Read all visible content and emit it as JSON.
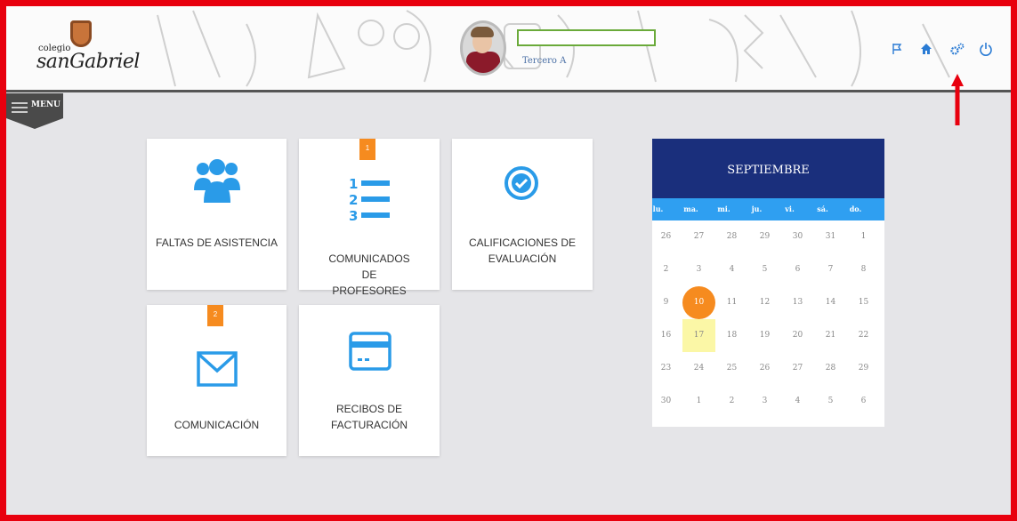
{
  "header": {
    "logo_small": "colegio",
    "logo_big": "sanGabriel",
    "student_name": "",
    "student_grade": "Tercero A",
    "icons": [
      "flag-icon",
      "home-icon",
      "settings-gears-icon",
      "power-icon"
    ]
  },
  "menu": {
    "label": "MENU"
  },
  "tiles": [
    {
      "title": "FALTAS DE ASISTENCIA",
      "icon": "users-icon",
      "badge": ""
    },
    {
      "title": "COMUNICADOS DE PROFESORES",
      "icon": "numbered-list-icon",
      "badge": "1"
    },
    {
      "title": "CALIFICACIONES DE EVALUACIÓN",
      "icon": "check-circle-icon",
      "badge": ""
    },
    {
      "title": "COMUNICACIÓN",
      "icon": "envelope-icon",
      "badge": "2"
    },
    {
      "title": "RECIBOS DE FACTURACIÓN",
      "icon": "credit-card-icon",
      "badge": ""
    }
  ],
  "calendar": {
    "month": "SEPTIEMBRE",
    "weekdays": [
      "lu.",
      "ma.",
      "mi.",
      "ju.",
      "vi.",
      "sá.",
      "do."
    ],
    "weeks": [
      [
        "26",
        "27",
        "28",
        "29",
        "30",
        "31",
        "1"
      ],
      [
        "2",
        "3",
        "4",
        "5",
        "6",
        "7",
        "8"
      ],
      [
        "9",
        "10",
        "11",
        "12",
        "13",
        "14",
        "15"
      ],
      [
        "16",
        "17",
        "18",
        "19",
        "20",
        "21",
        "22"
      ],
      [
        "23",
        "24",
        "25",
        "26",
        "27",
        "28",
        "29"
      ],
      [
        "30",
        "1",
        "2",
        "3",
        "4",
        "5",
        "6"
      ]
    ],
    "selected_day": "10",
    "today_day": "17",
    "colors": {
      "header": "#1a2f7c",
      "weekday_bar": "#2f9ff1",
      "selected": "#f68b1f",
      "today": "#fbf7a6"
    }
  },
  "colors": {
    "accent_blue": "#2a9be8",
    "badge_orange": "#f68b1f",
    "frame_red": "#e8000e"
  }
}
